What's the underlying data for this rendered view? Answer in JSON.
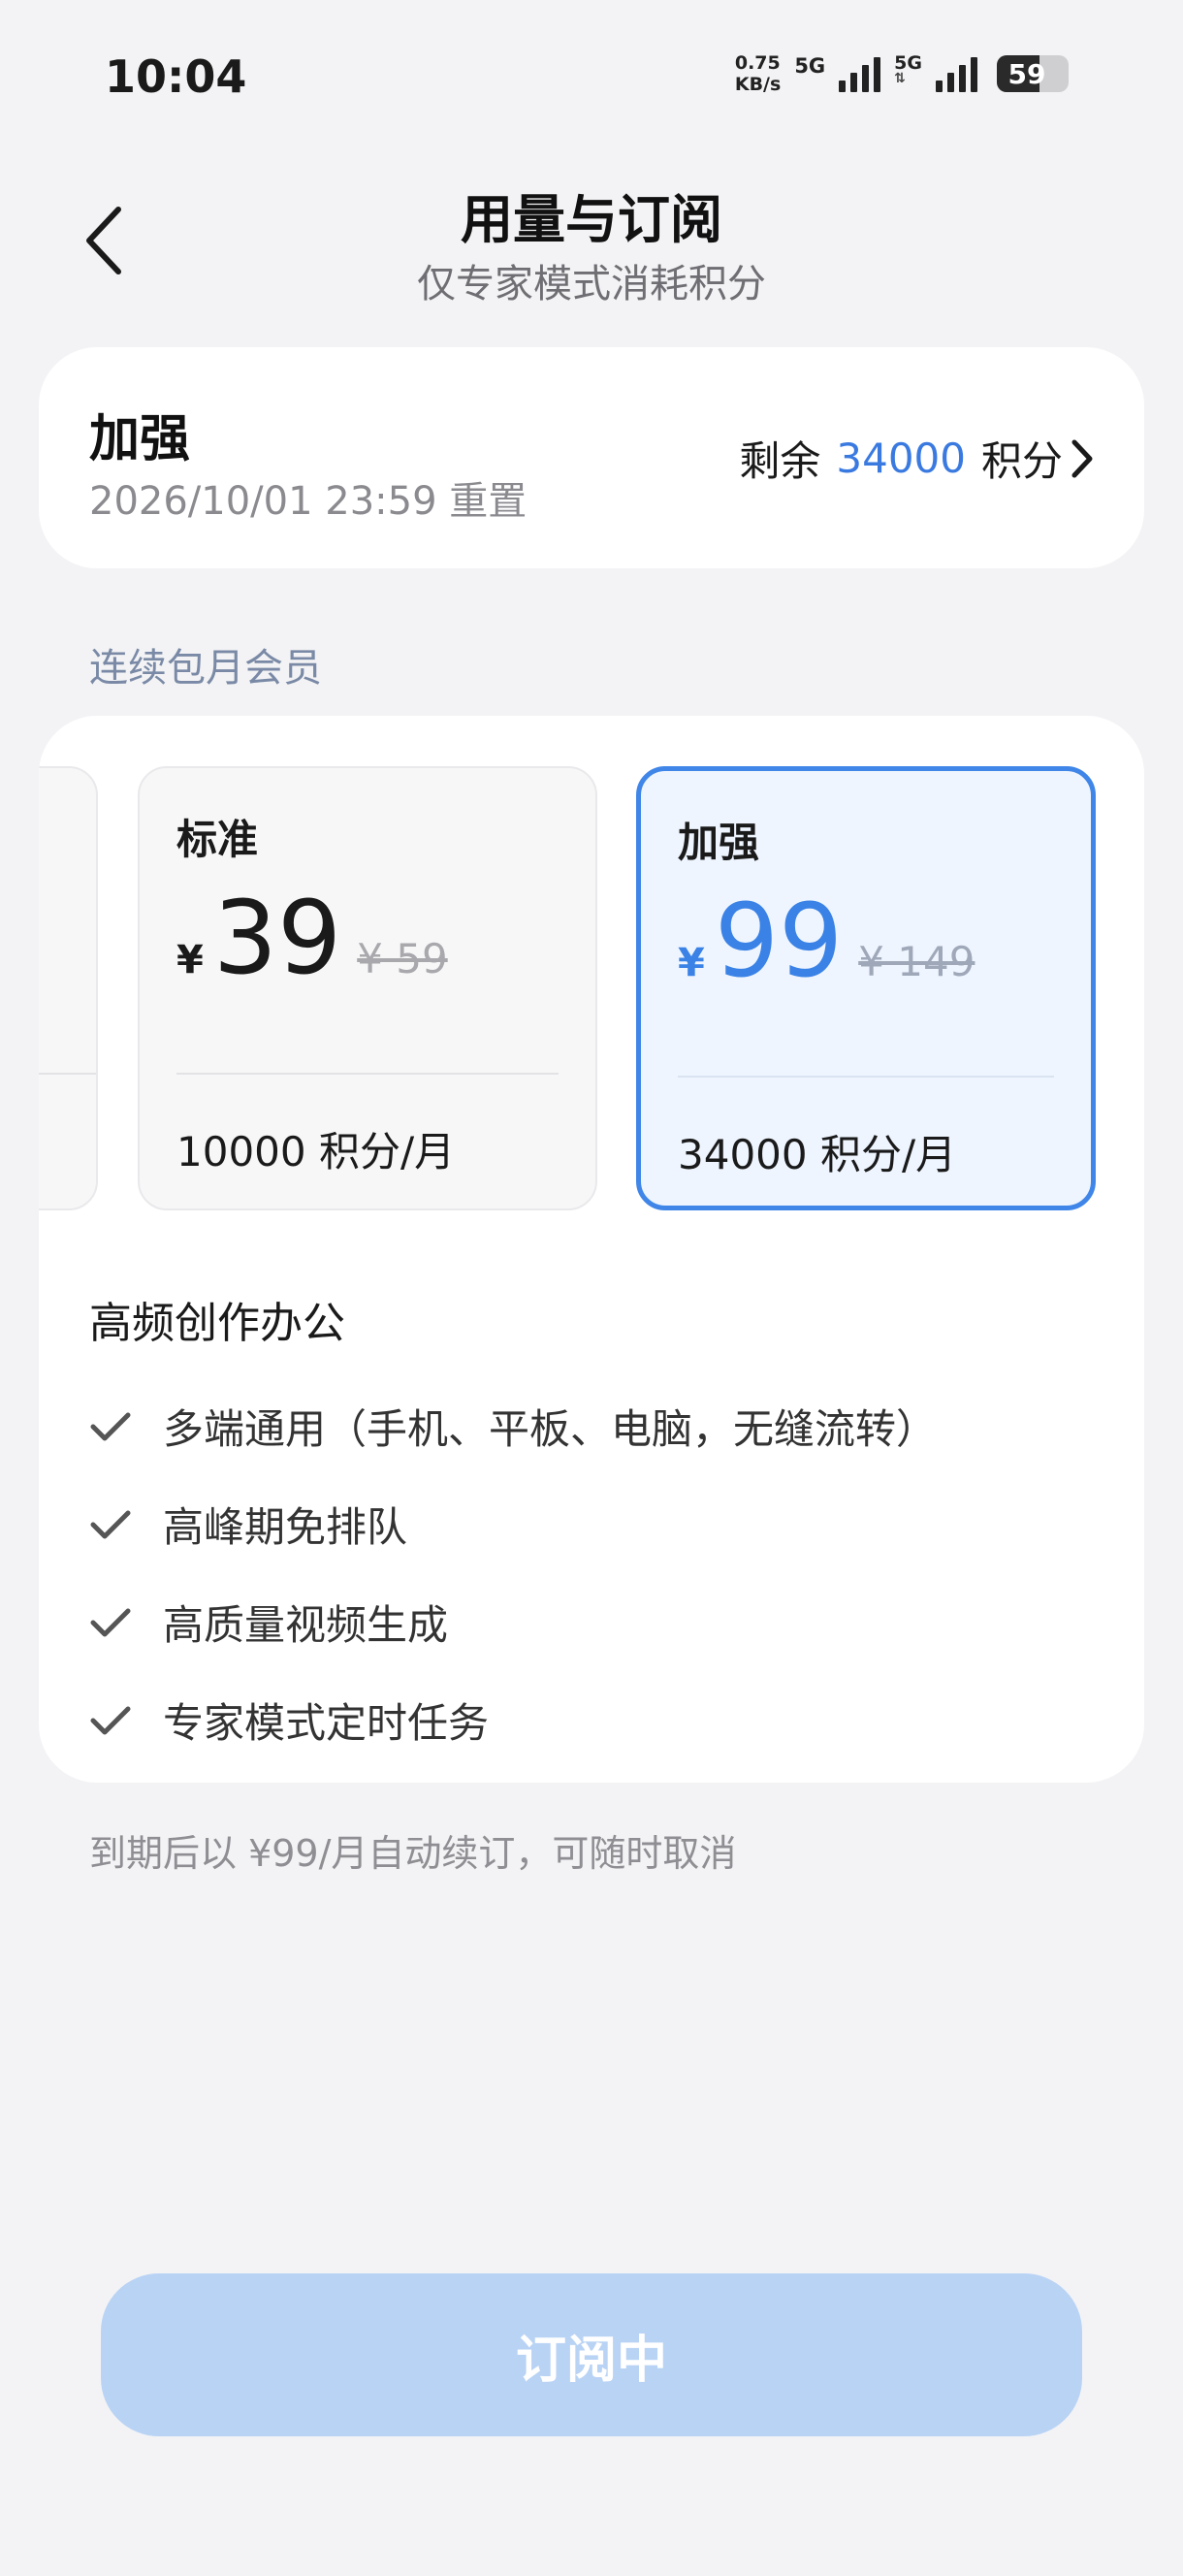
{
  "status_bar": {
    "time": "10:04",
    "net_speed_value": "0.75",
    "net_speed_unit": "KB/s",
    "network_1": "5G",
    "network_2": "5G",
    "battery": "59"
  },
  "header": {
    "title": "用量与订阅",
    "subtitle": "仅专家模式消耗积分"
  },
  "current_plan": {
    "name": "加强",
    "reset_date": "2026/10/01 23:59",
    "reset_label": "重置",
    "remaining_label": "剩余",
    "remaining_value": "34000",
    "remaining_unit": "积分"
  },
  "section": {
    "label": "连续包月会员"
  },
  "tiers": [
    {
      "name": "标准",
      "currency": "¥",
      "price": "39",
      "original_price": "¥ 59",
      "credits": "10000 积分/月",
      "selected": false
    },
    {
      "name": "加强",
      "currency": "¥",
      "price": "99",
      "original_price": "¥ 149",
      "credits": "34000 积分/月",
      "selected": true
    }
  ],
  "features": {
    "title": "高频创作办公",
    "items": [
      "多端通用（手机、平板、电脑，无缝流转）",
      "高峰期免排队",
      "高质量视频生成",
      "专家模式定时任务"
    ]
  },
  "renew_note": "到期后以 ¥99/月自动续订，可随时取消",
  "subscribe_button": {
    "label": "订阅中"
  },
  "colors": {
    "accent": "#3a82e6",
    "button_disabled": "#b9d3f5",
    "background": "#f3f3f5"
  }
}
